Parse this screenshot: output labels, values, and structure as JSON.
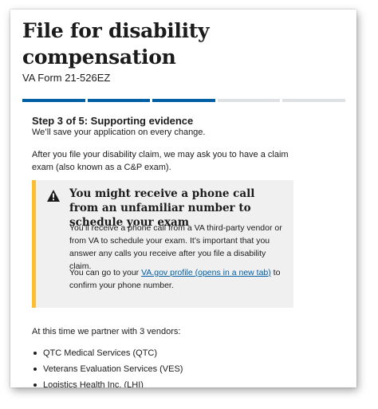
{
  "page": {
    "title": "File for disability compensation",
    "form_number": "VA Form 21-526EZ"
  },
  "progress": {
    "current_step": 3,
    "total_steps": 5
  },
  "step": {
    "heading": "Step 3 of 5: Supporting evidence",
    "save_note": "We’ll save your application on every change.",
    "intro": "After you file your disability claim, we may ask you to have a claim exam (also known as a C&P exam)."
  },
  "alert": {
    "icon": "warning-icon",
    "accent_color": "#ffbe2e",
    "heading": "You might receive a phone call from an unfamiliar number to schedule your exam",
    "body": "You’ll receive a phone call from a VA third-party vendor or from VA to schedule your exam. It’s important that you answer any calls you receive after you file a disability claim.",
    "body2_prefix": "You can go to your ",
    "link_text": "VA.gov profile (opens in a new tab)",
    "body2_suffix": " to confirm your phone number."
  },
  "partners": {
    "intro": "At this time we partner with 3 vendors:",
    "vendors": [
      "QTC Medical Services (QTC)",
      "Veterans Evaluation Services (VES)",
      "Logistics Health Inc. (LHI)"
    ]
  },
  "colors": {
    "progress_done": "#005ea2",
    "progress_todo": "#dfe1e2",
    "link": "#005ea2"
  }
}
